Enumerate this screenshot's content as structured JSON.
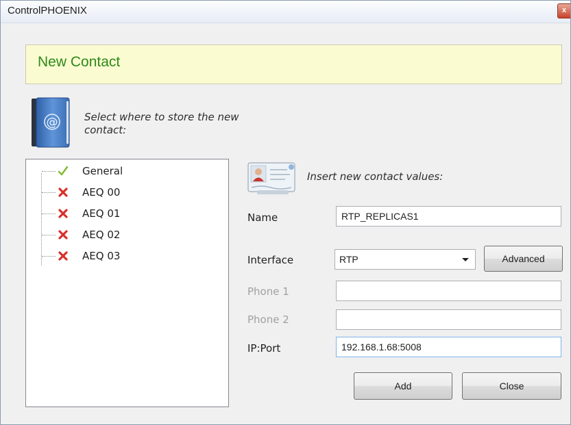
{
  "window": {
    "title": "ControlPHOENIX",
    "close_glyph": "x"
  },
  "header": {
    "title": "New Contact"
  },
  "store": {
    "prompt": "Select where to store the new contact:"
  },
  "tree": {
    "items": [
      {
        "label": "General",
        "status": "check"
      },
      {
        "label": "AEQ 00",
        "status": "cross"
      },
      {
        "label": "AEQ 01",
        "status": "cross"
      },
      {
        "label": "AEQ 02",
        "status": "cross"
      },
      {
        "label": "AEQ 03",
        "status": "cross"
      }
    ]
  },
  "form": {
    "prompt": "Insert new contact values:",
    "name": {
      "label": "Name",
      "value": "RTP_REPLICAS1"
    },
    "interface": {
      "label": "Interface",
      "value": "RTP",
      "advanced_label": "Advanced"
    },
    "phone1": {
      "label": "Phone 1",
      "value": ""
    },
    "phone2": {
      "label": "Phone 2",
      "value": ""
    },
    "ip_port": {
      "label": "IP:Port",
      "value": "192.168.1.68:5008"
    },
    "add_label": "Add",
    "close_label": "Close"
  },
  "colors": {
    "header_bg": "#fbfbd2",
    "header_text": "#2b8a17",
    "check": "#7cbb2a",
    "cross": "#d9302a"
  },
  "icons": {
    "book": "address-book-icon",
    "card": "contact-card-icon",
    "check": "checkmark-icon",
    "cross": "cross-icon",
    "dropdown": "chevron-down-icon"
  }
}
